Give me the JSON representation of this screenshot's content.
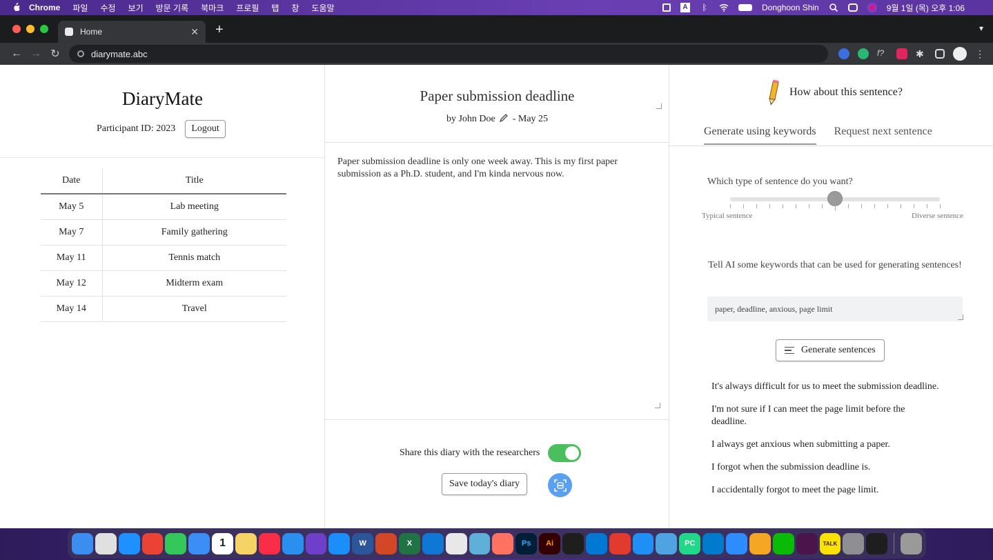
{
  "menubar": {
    "app": "Chrome",
    "items": [
      "파일",
      "수정",
      "보기",
      "방문 기록",
      "북마크",
      "프로필",
      "탭",
      "창",
      "도움말"
    ],
    "user": "Donghoon Shin",
    "datetime": "9월 1일 (목) 오후 1:06"
  },
  "browser": {
    "tab_title": "Home",
    "url": "diarymate.abc"
  },
  "left": {
    "brand": "DiaryMate",
    "participant_label": "Participant ID: 2023",
    "logout_label": "Logout",
    "table": {
      "headers": [
        "Date",
        "Title"
      ],
      "rows": [
        [
          "May 5",
          "Lab meeting"
        ],
        [
          "May 7",
          "Family gathering"
        ],
        [
          "May 11",
          "Tennis match"
        ],
        [
          "May 12",
          "Midterm exam"
        ],
        [
          "May 14",
          "Travel"
        ]
      ]
    }
  },
  "editor": {
    "title": "Paper submission deadline",
    "author": "by John Doe",
    "date": "- May 25",
    "body": "Paper submission deadline is only one week away. This is my first paper submission as a Ph.D. student, and I'm kinda nervous now.",
    "share_label": "Share this diary with the researchers",
    "share_enabled": true,
    "save_label": "Save today's diary"
  },
  "assistant": {
    "heading": "How about this sentence?",
    "tabs": [
      "Generate using keywords",
      "Request next sentence"
    ],
    "active_tab": 0,
    "type_question": "Which type of sentence do you want?",
    "slider_min_label": "Typical sentence",
    "slider_max_label": "Diverse sentence",
    "slider_value": 0.5,
    "slider_ticks": 17,
    "keywords_prompt": "Tell AI some keywords that can be used for generating sentences!",
    "keywords_value": "paper, deadline, anxious, page limit",
    "generate_label": "Generate sentences",
    "sentences": [
      "It's always difficult for us to meet the submission deadline.",
      "I'm not sure if I can meet the page limit before the deadline.",
      "I always get anxious when submitting a paper.",
      "I forgot when the submission deadline is.",
      "I accidentally forgot to meet the page limit."
    ]
  },
  "colors": {
    "toggle_on": "#4bbf5b",
    "scan_button": "#5aa0f0"
  },
  "dock": {
    "apps": [
      {
        "name": "finder",
        "color": "#3b8df0"
      },
      {
        "name": "launchpad",
        "color": "#e0e0e0"
      },
      {
        "name": "safari",
        "color": "#1e90ff"
      },
      {
        "name": "chrome",
        "color": "#ea4335"
      },
      {
        "name": "messages",
        "color": "#34c759"
      },
      {
        "name": "mail",
        "color": "#3a8ef6"
      },
      {
        "name": "calendar",
        "color": "#ffffff",
        "text": "1"
      },
      {
        "name": "notes",
        "color": "#f6d365"
      },
      {
        "name": "music",
        "color": "#fa2d48"
      },
      {
        "name": "keynote",
        "color": "#2b8ff0"
      },
      {
        "name": "github",
        "color": "#6e40c9"
      },
      {
        "name": "app-store",
        "color": "#1c8ef9"
      },
      {
        "name": "word",
        "color": "#2b579a",
        "text": "W"
      },
      {
        "name": "powerpoint",
        "color": "#d24726"
      },
      {
        "name": "excel",
        "color": "#217346",
        "text": "X"
      },
      {
        "name": "outlook",
        "color": "#0f78d4"
      },
      {
        "name": "textedit",
        "color": "#e8e8e8"
      },
      {
        "name": "preview",
        "color": "#5fb0d8"
      },
      {
        "name": "figma-slides",
        "color": "#ff7262"
      },
      {
        "name": "photoshop",
        "color": "#001e36",
        "text": "Ps"
      },
      {
        "name": "illustrator",
        "color": "#330000",
        "text": "Ai"
      },
      {
        "name": "figma",
        "color": "#1e1e1e"
      },
      {
        "name": "windows",
        "color": "#0078d4"
      },
      {
        "name": "acrobat",
        "color": "#e23a2e"
      },
      {
        "name": "xcode",
        "color": "#1d8ff5"
      },
      {
        "name": "network",
        "color": "#4fa3e0"
      },
      {
        "name": "pycharm",
        "color": "#21d789",
        "text": "PC"
      },
      {
        "name": "vscode",
        "color": "#007acc"
      },
      {
        "name": "zoom",
        "color": "#2d8cff"
      },
      {
        "name": "transmit",
        "color": "#f5a623"
      },
      {
        "name": "wechat",
        "color": "#09bb07"
      },
      {
        "name": "slack",
        "color": "#4a154b"
      },
      {
        "name": "kakaotalk",
        "color": "#fae100",
        "text": "TALK"
      },
      {
        "name": "system-settings",
        "color": "#8e8e93"
      },
      {
        "name": "terminal",
        "color": "#1e1e1e"
      },
      {
        "name": "trash",
        "color": "#9a9a9a"
      }
    ]
  }
}
